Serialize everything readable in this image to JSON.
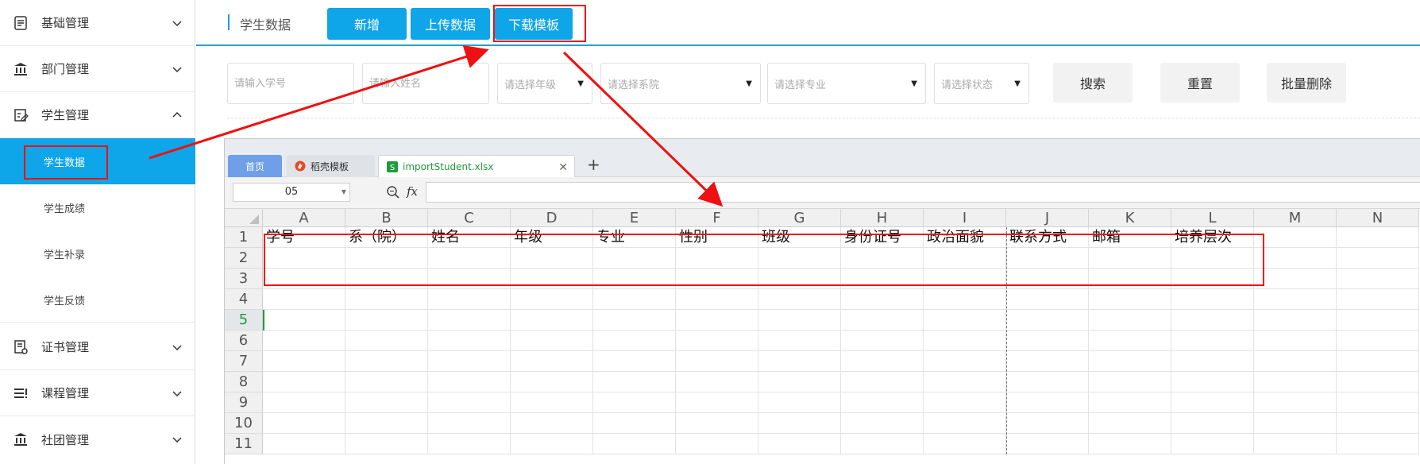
{
  "sidebar": {
    "items": [
      {
        "label": "基础管理",
        "icon": "document-list-icon",
        "expanded": false
      },
      {
        "label": "部门管理",
        "icon": "bank-building-icon",
        "expanded": false
      },
      {
        "label": "学生管理",
        "icon": "student-form-icon",
        "expanded": true
      },
      {
        "label": "证书管理",
        "icon": "certificate-icon",
        "expanded": false
      },
      {
        "label": "课程管理",
        "icon": "course-list-icon",
        "expanded": false
      },
      {
        "label": "社团管理",
        "icon": "bank-building-icon",
        "expanded": false
      }
    ],
    "sub_items": [
      {
        "label": "学生数据",
        "active": true
      },
      {
        "label": "学生成绩",
        "active": false
      },
      {
        "label": "学生补录",
        "active": false
      },
      {
        "label": "学生反馈",
        "active": false
      }
    ]
  },
  "header": {
    "breadcrumb": "学生数据",
    "buttons": {
      "add": "新增",
      "upload": "上传数据",
      "download_template": "下载模板"
    },
    "accent_color": "#0ea5e9"
  },
  "filters": {
    "student_id_placeholder": "请输入学号",
    "name_placeholder": "请输入姓名",
    "grade": "请选择年级",
    "college": "请选择系院",
    "major": "请选择专业",
    "status": "请选择状态",
    "search_label": "搜索",
    "reset_label": "重置",
    "batch_delete_label": "批量删除"
  },
  "spreadsheet": {
    "tabs": {
      "home": "首页",
      "docer": "稻壳模板",
      "file": "importStudent.xlsx"
    },
    "name_box": "05",
    "fx_label": "fx",
    "columns": [
      "A",
      "B",
      "C",
      "D",
      "E",
      "F",
      "G",
      "H",
      "I",
      "J",
      "K",
      "L",
      "M",
      "N"
    ],
    "rows": [
      "1",
      "2",
      "3",
      "4",
      "5",
      "6",
      "7",
      "8",
      "9",
      "10",
      "11"
    ],
    "selected_row": "5",
    "header_row": [
      "学号",
      "系（院）",
      "姓名",
      "年级",
      "专业",
      "性别",
      "班级",
      "身份证号",
      "政治面貌",
      "联系方式",
      "邮箱",
      "培养层次"
    ]
  },
  "annotation_color": "#ee1111"
}
